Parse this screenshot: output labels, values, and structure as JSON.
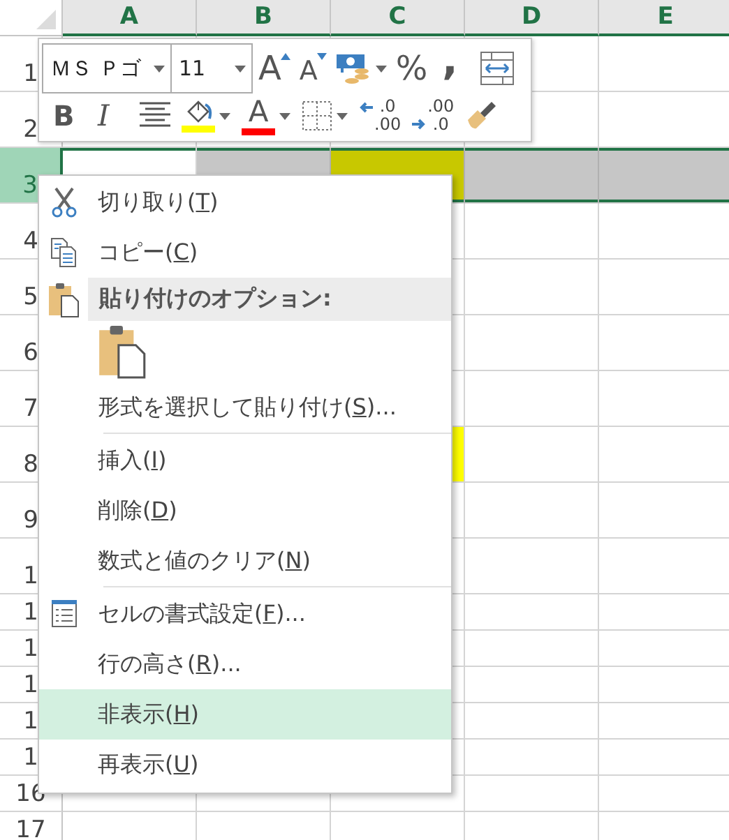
{
  "sheet": {
    "columns": [
      "A",
      "B",
      "C",
      "D",
      "E"
    ],
    "rows": [
      {
        "label": "1",
        "selected": false
      },
      {
        "label": "2",
        "selected": false
      },
      {
        "label": "3",
        "selected": true,
        "cells": [
          {
            "active": true
          },
          {
            "active": false
          },
          {
            "active": false,
            "color": "#c8c800"
          },
          {
            "active": false
          },
          {
            "active": false
          }
        ]
      },
      {
        "label": "4",
        "selected": false
      },
      {
        "label": "5",
        "selected": false
      },
      {
        "label": "6",
        "selected": false
      },
      {
        "label": "7",
        "selected": false
      },
      {
        "label": "8",
        "selected": false,
        "cells": [
          null,
          null,
          {
            "color": "#ffff00"
          },
          null,
          null
        ]
      },
      {
        "label": "9",
        "selected": false
      },
      {
        "label": "1",
        "selected": false
      },
      {
        "label": "1",
        "selected": false
      },
      {
        "label": "1",
        "selected": false
      },
      {
        "label": "1",
        "selected": false
      },
      {
        "label": "1",
        "selected": false
      },
      {
        "label": "1",
        "selected": false
      },
      {
        "label": "16",
        "selected": false
      },
      {
        "label": "17",
        "selected": false
      }
    ]
  },
  "mini_toolbar": {
    "top_row": [
      {
        "kind": "font",
        "value": "ＭＳ Ｐゴ"
      },
      {
        "kind": "size",
        "value": "11"
      },
      {
        "kind": "grow",
        "label": "A"
      },
      {
        "kind": "shrink",
        "label": "A"
      },
      {
        "kind": "accounting",
        "dropdown": true
      },
      {
        "kind": "percent",
        "label": "%"
      },
      {
        "kind": "comma",
        "label": ","
      },
      {
        "kind": "wrap"
      }
    ],
    "bottom_row": [
      {
        "kind": "bold",
        "label": "B"
      },
      {
        "kind": "italic",
        "label": "I"
      },
      {
        "kind": "center"
      },
      {
        "kind": "fill",
        "color": "#ffff00",
        "dropdown": true
      },
      {
        "kind": "fontcolor",
        "label": "A",
        "color": "#ff0000",
        "dropdown": true
      },
      {
        "kind": "borders",
        "dropdown": true
      },
      {
        "kind": "incdec",
        "top": ".0",
        "bottom": ".00"
      },
      {
        "kind": "decdec",
        "top": ".00",
        "bottom": ".0"
      },
      {
        "kind": "painter"
      }
    ]
  },
  "context_menu": {
    "items": [
      {
        "kind": "cut",
        "text": "切り取り(",
        "access_key": "T",
        "after": ")",
        "selected": false
      },
      {
        "kind": "copy",
        "text": "コピー(",
        "access_key": "C",
        "after": ")",
        "selected": false
      },
      {
        "kind": "header",
        "text": "貼り付けのオプション:"
      },
      {
        "kind": "paste"
      },
      {
        "kind": "plain",
        "text": "形式を選択して貼り付け(",
        "access_key": "S",
        "after": ")...",
        "selected": false
      },
      {
        "kind": "separator"
      },
      {
        "kind": "plain",
        "text": "挿入(",
        "access_key": "I",
        "after": ")",
        "selected": false
      },
      {
        "kind": "plain",
        "text": "削除(",
        "access_key": "D",
        "after": ")",
        "selected": false
      },
      {
        "kind": "plain",
        "text": "数式と値のクリア(",
        "access_key": "N",
        "after": ")",
        "selected": false
      },
      {
        "kind": "separator"
      },
      {
        "kind": "format",
        "text": "セルの書式設定(",
        "access_key": "F",
        "after": ")...",
        "selected": false
      },
      {
        "kind": "plain",
        "text": "行の高さ(",
        "access_key": "R",
        "after": ")...",
        "selected": false
      },
      {
        "kind": "plain",
        "text": "非表示(",
        "access_key": "H",
        "after": ")",
        "selected": true
      },
      {
        "kind": "plain",
        "text": "再表示(",
        "access_key": "U",
        "after": ")",
        "selected": false
      }
    ]
  }
}
